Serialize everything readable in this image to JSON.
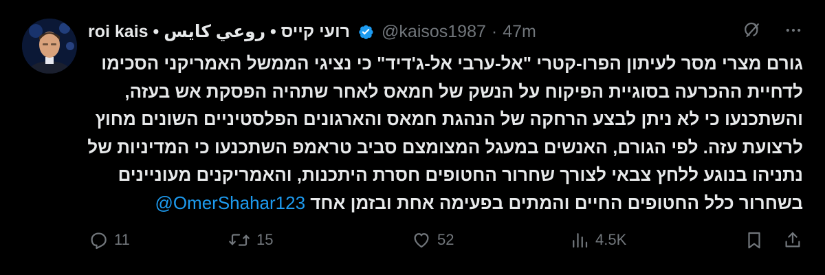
{
  "author": {
    "display_name": "roi kais • רועי קייס • روعي كايس",
    "handle": "@kaisos1987",
    "separator": "·",
    "time": "47m",
    "verified": true
  },
  "tweet": {
    "lines": [
      "גורם מצרי מסר לעיתון הפרו-קטרי \"אל-ערבי אל-ג'דיד\" כי נציגי הממשל האמריקני הסכימו",
      "לדחיית ההכרעה בסוגיית הפיקוח על הנשק של חמאס לאחר שתהיה הפסקת אש בעזה,",
      "והשתכנעו כי לא ניתן לבצע הרחקה של הנהגת חמאס והארגונים הפלסטיניים השונים מחוץ",
      "לרצועת עזה. לפי הגורם, האנשים במעגל המצומצם סביב טראמפ השתכנעו כי המדיניות של",
      "נתניהו בנוגע ללחץ צבאי לצורך שחרור החטופים חסרת היתכנות, והאמריקנים מעוניינים"
    ],
    "last_line_text": "בשחרור כלל החטופים החיים והמתים בפעימה אחת ובזמן אחד",
    "mention": "@OmerShahar123"
  },
  "stats": {
    "replies": "11",
    "reposts": "15",
    "likes": "52",
    "views": "4.5K"
  },
  "icons": {
    "verified": "verified-badge-icon",
    "grok": "grok-icon",
    "more": "more-icon",
    "reply": "reply-icon",
    "repost": "repost-icon",
    "like": "like-icon",
    "views": "views-icon",
    "bookmark": "bookmark-icon",
    "share": "share-icon"
  },
  "colors": {
    "background": "#000000",
    "text": "#e7e9ea",
    "secondary": "#71767b",
    "accent": "#1d9bf0"
  }
}
